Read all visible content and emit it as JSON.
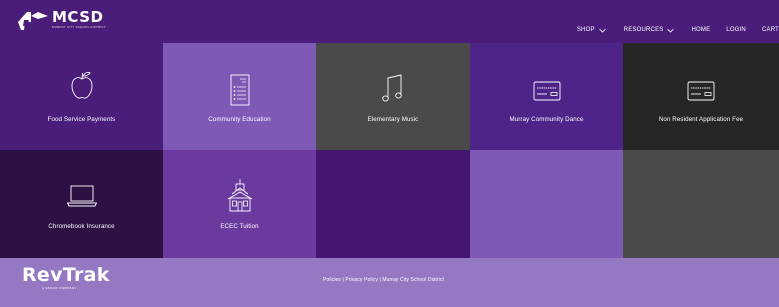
{
  "header": {
    "logo_title": "MCSD",
    "logo_subtitle": "MURRAY CITY SCHOOL DISTRICT",
    "nav": [
      {
        "label": "SHOP",
        "has_dropdown": true
      },
      {
        "label": "RESOURCES",
        "has_dropdown": true
      },
      {
        "label": "HOME",
        "has_dropdown": false
      },
      {
        "label": "LOGIN",
        "has_dropdown": false
      },
      {
        "label": "CART",
        "has_dropdown": false
      }
    ]
  },
  "tiles": [
    {
      "label": "Food Service Payments",
      "icon": "apple-icon"
    },
    {
      "label": "Community Education",
      "icon": "document-list-icon"
    },
    {
      "label": "Elementary Music",
      "icon": "music-note-icon"
    },
    {
      "label": "Murray Community Dance",
      "icon": "card-icon"
    },
    {
      "label": "Non Resident Application Fee",
      "icon": "card-icon"
    },
    {
      "label": "Chromebook Insurance",
      "icon": "laptop-icon"
    },
    {
      "label": "ECEC Tuition",
      "icon": "schoolhouse-icon"
    },
    {
      "label": "",
      "icon": ""
    },
    {
      "label": "",
      "icon": ""
    },
    {
      "label": "",
      "icon": ""
    }
  ],
  "colors": {
    "header": "#4a1d7a",
    "tile_1": "#4a1d7a",
    "tile_2": "#7e59b5",
    "tile_3": "#4a4a4a",
    "tile_4": "#4f2488",
    "tile_5": "#262626",
    "tile_6": "#2d1044",
    "tile_7": "#6a3a9e",
    "tile_8": "#45166f",
    "tile_9": "#7e59b5",
    "tile_10": "#4a4a4a",
    "footer": "#9478c1"
  },
  "footer": {
    "brand": "RevTrak",
    "brand_subtitle": "A VANCO COMPANY",
    "links": [
      {
        "label": "Policies"
      },
      {
        "label": "Privacy Policy"
      },
      {
        "label": "Murray City School District"
      }
    ],
    "separator": " | "
  }
}
